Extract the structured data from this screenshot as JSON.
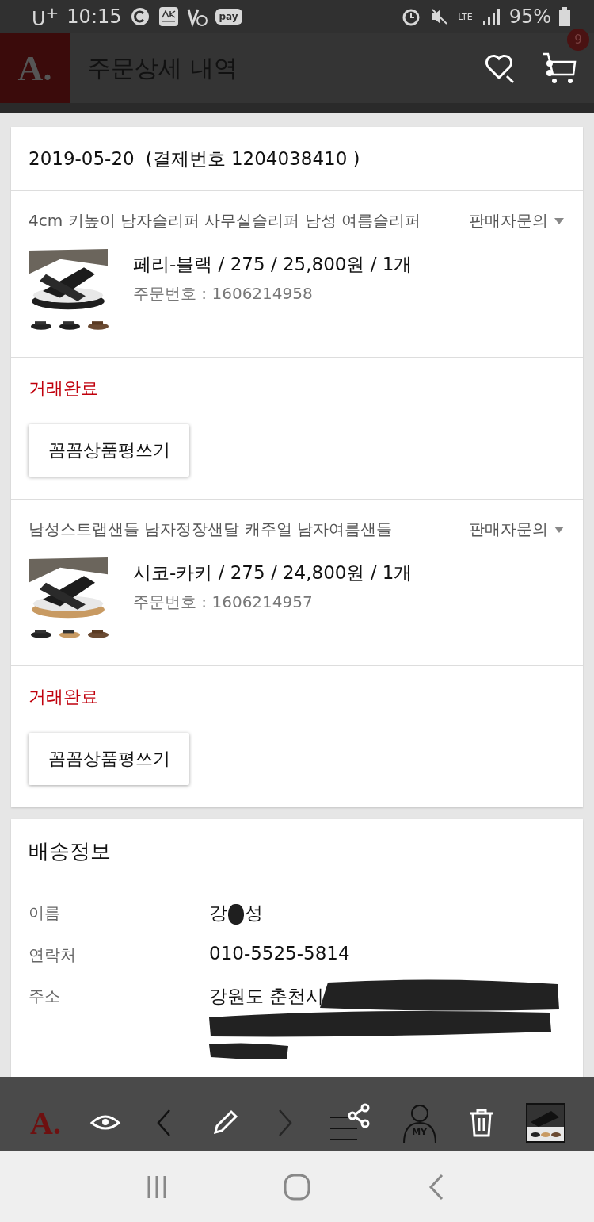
{
  "status_bar": {
    "carrier": "U$^{+}$",
    "time": "10:15",
    "pay_label": "pay",
    "network": "LTE",
    "battery": "95%"
  },
  "header": {
    "logo": "A.",
    "title": "주문상세 내역",
    "cart_count": "9"
  },
  "order": {
    "date": "2019-05-20",
    "payment": "(결제번호 1204038410 )",
    "items": [
      {
        "name": "4cm 키높이 남자슬리퍼 사무실슬리퍼 남성 여름슬리퍼",
        "inquiry": "판매자문의",
        "option": "페리-블랙 / 275 / 25,800원 / 1개",
        "order_no": "주문번호 : 1606214958",
        "status": "거래완료",
        "review_button": "꼼꼼상품평쓰기"
      },
      {
        "name": "남성스트랩샌들 남자정장샌달 캐주얼 남자여름샌들",
        "inquiry": "판매자문의",
        "option": "시코-카키 / 275 / 24,800원 / 1개",
        "order_no": "주문번호 : 1606214957",
        "status": "거래완료",
        "review_button": "꼼꼼상품평쓰기"
      }
    ]
  },
  "shipping": {
    "title": "배송정보",
    "rows": [
      {
        "label": "이름",
        "kind": "redacted-name",
        "parts": [
          "강",
          "성"
        ]
      },
      {
        "label": "연락처",
        "kind": "text",
        "value": "010-5525-5814"
      },
      {
        "label": "주소",
        "kind": "redacted-address",
        "value": "강원도 춘천시"
      }
    ]
  },
  "toolbar": {
    "logo": "A.",
    "my_label": "MY"
  }
}
